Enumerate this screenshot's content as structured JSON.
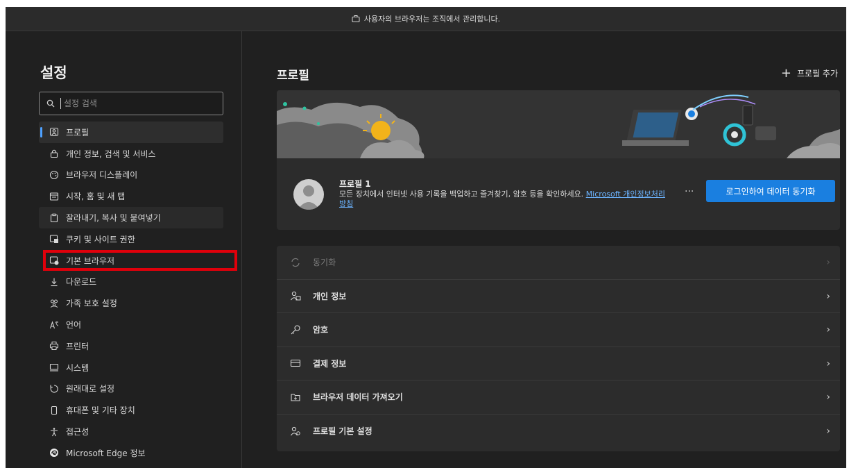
{
  "managed_bar": {
    "text": "사용자의 브라우저는 조직에서 관리합니다."
  },
  "sidebar": {
    "title": "설정",
    "search_placeholder": "설정 검색",
    "items": [
      {
        "label": "프로필",
        "icon": "profile-icon"
      },
      {
        "label": "개인 정보, 검색 및 서비스",
        "icon": "lock-icon"
      },
      {
        "label": "브라우저 디스플레이",
        "icon": "palette-icon"
      },
      {
        "label": "시작, 홈 및 새 탭",
        "icon": "home-tab-icon"
      },
      {
        "label": "잘라내기, 복사 및 붙여넣기",
        "icon": "clipboard-icon"
      },
      {
        "label": "쿠키 및 사이트 권한",
        "icon": "cookie-icon"
      },
      {
        "label": "기본 브라우저",
        "icon": "default-browser-icon"
      },
      {
        "label": "다운로드",
        "icon": "download-icon"
      },
      {
        "label": "가족 보호 설정",
        "icon": "family-icon"
      },
      {
        "label": "언어",
        "icon": "language-icon"
      },
      {
        "label": "프린터",
        "icon": "printer-icon"
      },
      {
        "label": "시스템",
        "icon": "system-icon"
      },
      {
        "label": "원래대로 설정",
        "icon": "reset-icon"
      },
      {
        "label": "휴대폰 및 기타 장치",
        "icon": "phone-icon"
      },
      {
        "label": "접근성",
        "icon": "accessibility-icon"
      },
      {
        "label": "Microsoft Edge 정보",
        "icon": "edge-logo-icon"
      }
    ]
  },
  "main": {
    "title": "프로필",
    "add_profile": "프로필 추가",
    "profile": {
      "name": "프로필 1",
      "desc": "모든 장치에서 인터넷 사용 기록을 백업하고 즐겨찾기, 암호 등을 확인하세요.",
      "link": "Microsoft 개인정보처리방침",
      "more": "···",
      "sync_button": "로그인하여 데이터 동기화"
    },
    "rows": [
      {
        "label": "동기화",
        "icon": "sync-icon",
        "disabled": true
      },
      {
        "label": "개인 정보",
        "icon": "personal-info-icon"
      },
      {
        "label": "암호",
        "icon": "key-icon"
      },
      {
        "label": "결제 정보",
        "icon": "card-icon"
      },
      {
        "label": "브라우저 데이터 가져오기",
        "icon": "import-icon"
      },
      {
        "label": "프로필 기본 설정",
        "icon": "profile-settings-icon"
      }
    ],
    "chevron": "›"
  },
  "colors": {
    "accent": "#1a7fe0",
    "highlight": "#e0000b",
    "link": "#6cb4ff"
  }
}
